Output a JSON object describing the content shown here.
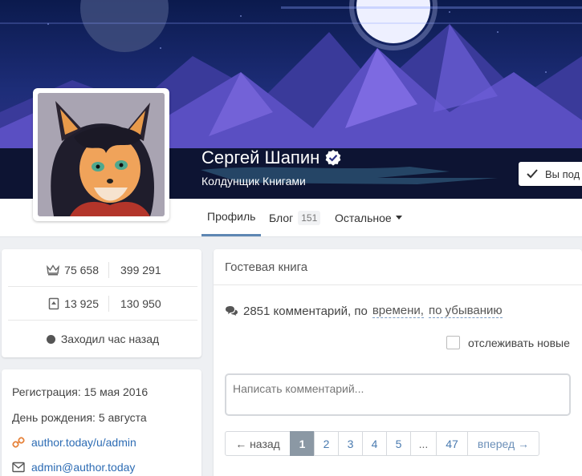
{
  "profile": {
    "name": "Сергей Шапин",
    "subtitle": "Колдунщик Книгами"
  },
  "follow_button": {
    "label": "Вы под"
  },
  "tabs": [
    {
      "label": "Профиль"
    },
    {
      "label": "Блог",
      "count": "151"
    },
    {
      "label": "Остальное"
    }
  ],
  "stats": {
    "rating_left": "75 658",
    "rating_right": "399 291",
    "books_left": "13 925",
    "books_right": "130 950",
    "last_seen": "Заходил час назад"
  },
  "info": {
    "registration": "Регистрация: 15 мая 2016",
    "birthday": "День рождения: 5 августа",
    "link": "author.today/u/admin",
    "email": "admin@author.today"
  },
  "guestbook": {
    "title": "Гостевая книга",
    "count_text": "2851 комментарий, по",
    "sort_by": "времени,",
    "sort_order": "по убыванию",
    "track_label": "отслеживать новые",
    "comment_placeholder": "Написать комментарий...",
    "pager": {
      "prev": "← назад",
      "pages": [
        "1",
        "2",
        "3",
        "4",
        "5",
        "...",
        "47"
      ],
      "next": "вперед →"
    }
  },
  "colors": {
    "accent": "#5e87b3",
    "link": "#2d6cb4",
    "active_page": "#8b98a4"
  }
}
